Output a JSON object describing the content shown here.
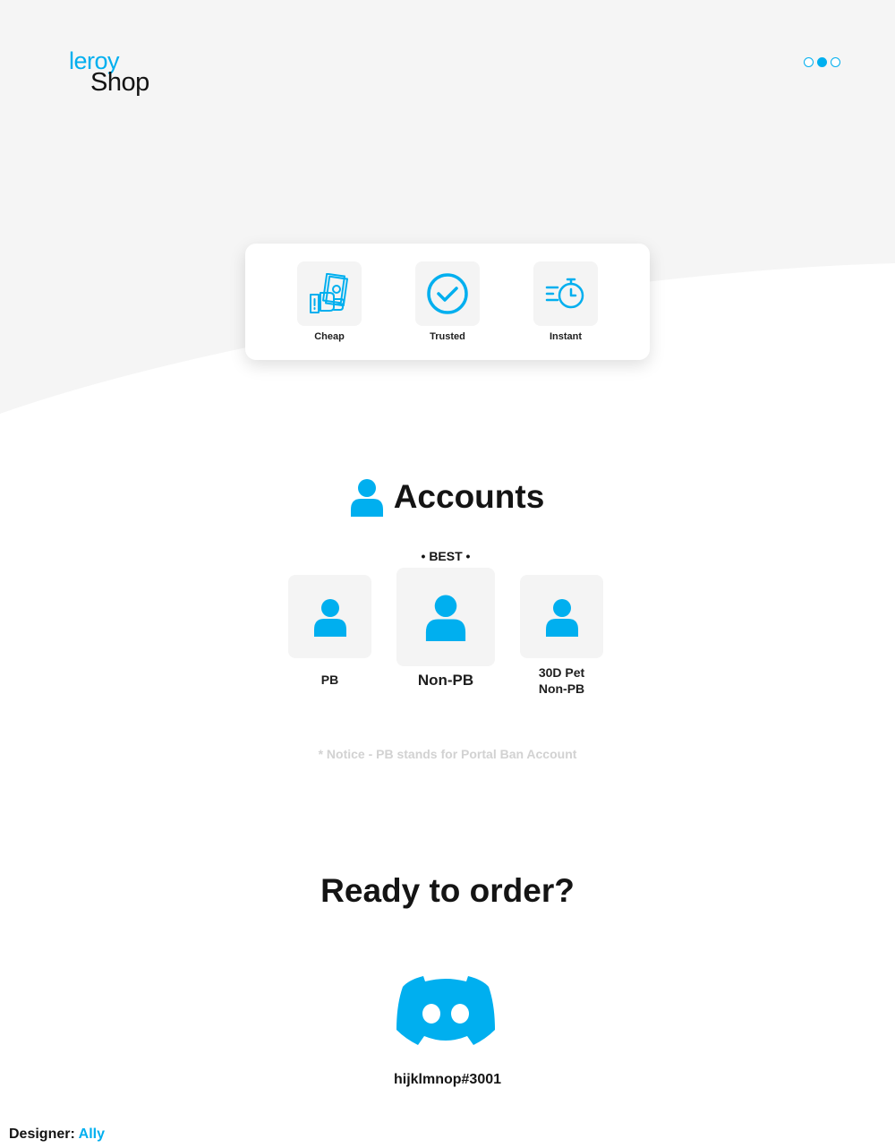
{
  "brand": {
    "logo_top": "leroy",
    "logo_bottom": "Shop",
    "accent_color": "#00afef"
  },
  "pager": {
    "total": 3,
    "active_index": 1
  },
  "features": [
    {
      "label": "Cheap",
      "icon": "cash-hand-icon"
    },
    {
      "label": "Trusted",
      "icon": "check-circle-icon"
    },
    {
      "label": "Instant",
      "icon": "fast-stopwatch-icon"
    }
  ],
  "accounts": {
    "title": "Accounts",
    "title_icon": "user-icon",
    "best_badge": "• BEST •",
    "items": [
      {
        "label": "PB",
        "icon": "user-icon"
      },
      {
        "label": "Non-PB",
        "icon": "user-icon",
        "featured": true
      },
      {
        "label_line1": "30D Pet",
        "label_line2": "Non-PB",
        "icon": "user-icon"
      }
    ],
    "notice": "* Notice - PB stands for Portal Ban Account"
  },
  "order": {
    "title": "Ready to order?",
    "icon": "discord-icon",
    "discord_tag": "hijklmnop#3001"
  },
  "credit": {
    "prefix": "Designer:",
    "name": "Ally"
  }
}
